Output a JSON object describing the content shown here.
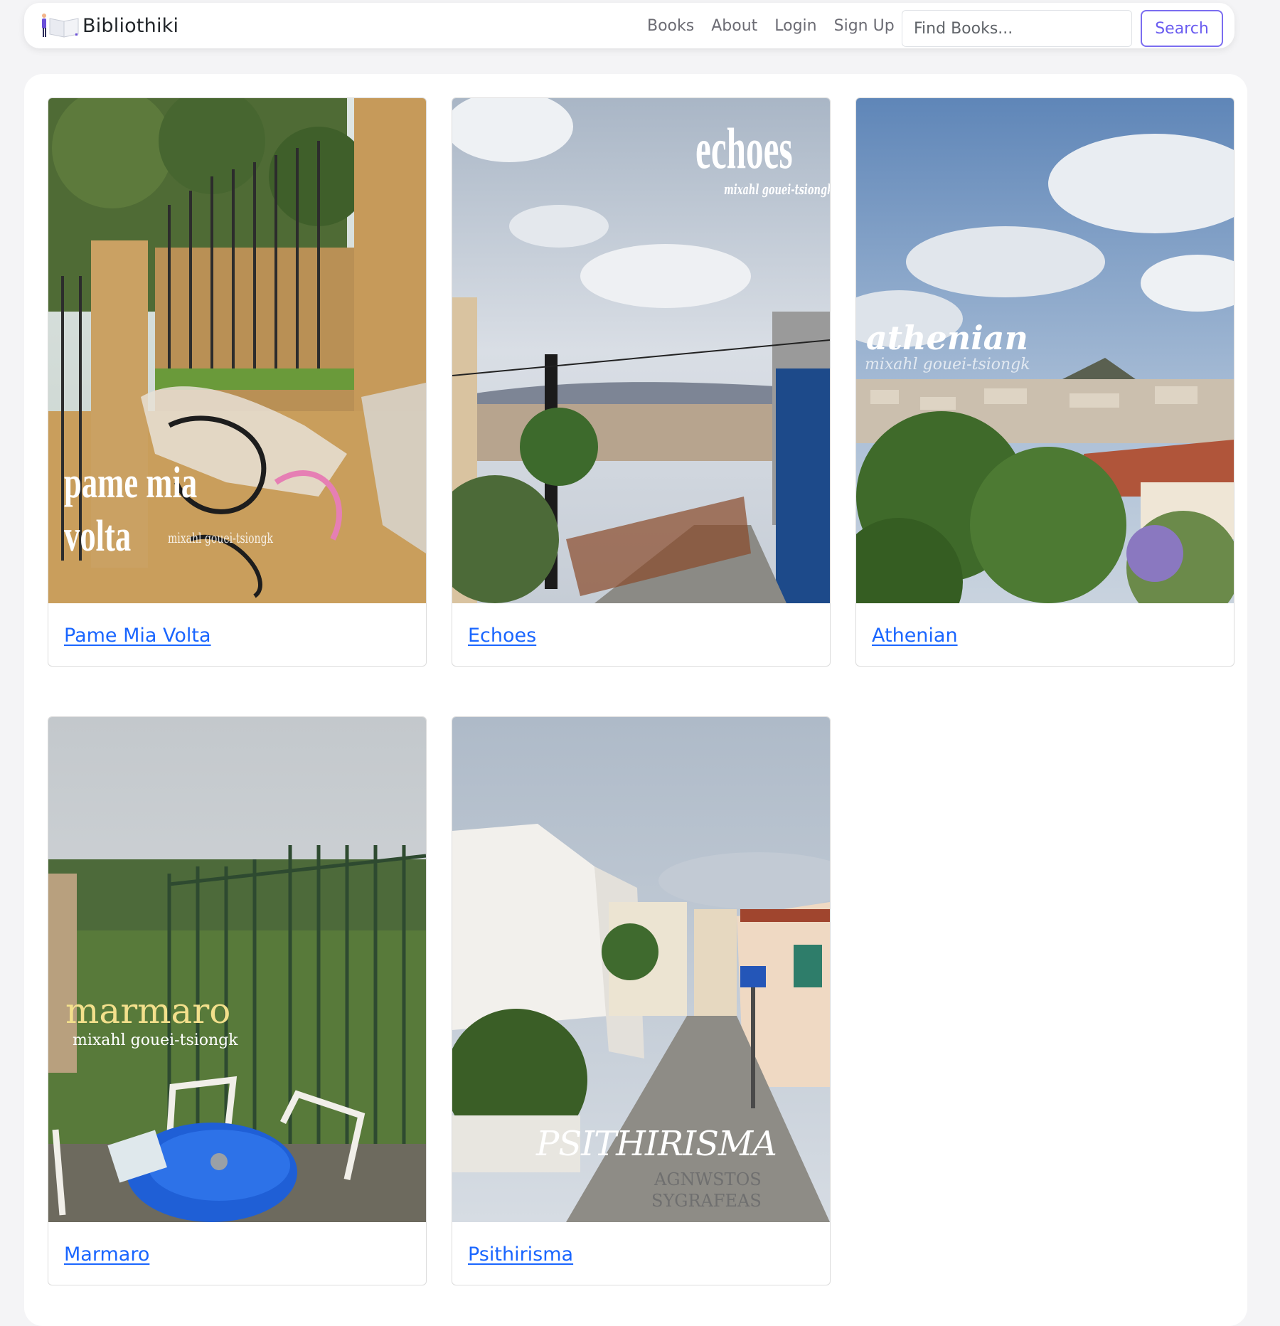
{
  "brand": {
    "name": "Bibliothiki",
    "logo_icon": "book-reader-logo-icon"
  },
  "nav": {
    "links": [
      "Books",
      "About",
      "Login",
      "Sign Up"
    ],
    "search": {
      "placeholder": "Find Books...",
      "button_label": "Search"
    }
  },
  "colors": {
    "accent": "#6a5cf0",
    "link": "#1a66ff"
  },
  "books": [
    {
      "title": "Pame Mia Volta",
      "cover": {
        "title_line1": "pame mia",
        "title_line2": "volta",
        "author": "mixahl gouei-tsiongk",
        "text_color": "#ffffff"
      }
    },
    {
      "title": "Echoes",
      "cover": {
        "title": "echoes",
        "author": "mixahl gouei-tsiongk",
        "text_color": "#ffffff"
      }
    },
    {
      "title": "Athenian",
      "cover": {
        "title": "athenian",
        "author": "mixahl gouei-tsiongk",
        "text_color": "#ffffff"
      }
    },
    {
      "title": "Marmaro",
      "cover": {
        "title": "marmaro",
        "author": "mixahl gouei-tsiongk",
        "text_color": "#f3e08c"
      }
    },
    {
      "title": "Psithirisma",
      "cover": {
        "title": "PSITHIRISMA",
        "author_line1": "AGNWSTOS",
        "author_line2": "SYGRAFEAS",
        "text_color": "#ffffff"
      }
    }
  ]
}
